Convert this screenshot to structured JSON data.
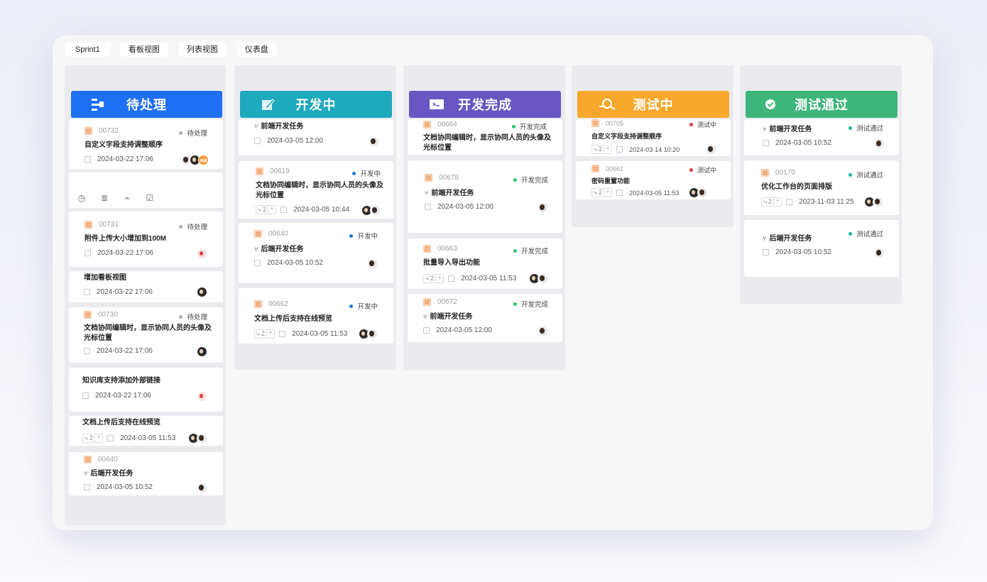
{
  "tabs": [
    "Sprint1",
    "看板视图",
    "列表视图",
    "仪表盘"
  ],
  "colors": {
    "todo": "#1f6ff5",
    "dev": "#1ea9bd",
    "done": "#6a56c2",
    "test": "#f7a82c",
    "pass": "#3db57b"
  },
  "columns": [
    {
      "title": "待处理",
      "cards": [
        {
          "id": "00732",
          "status": "待处理",
          "title": "自定义字段支持调整顺序",
          "date": "2024-03-22 17:06",
          "avatar_badge": "张楠"
        },
        {
          "tools": [
            "clock-icon",
            "list-icon",
            "attach-icon",
            "checkbox-icon"
          ]
        },
        {
          "id": "00731",
          "status": "待处理",
          "title": "附件上传大小增加到100M",
          "date": "2024-03-22 17:06"
        },
        {
          "title": "增加看板视图",
          "date": "2024-03-22 17:06"
        },
        {
          "id": "00730",
          "status": "待处理",
          "title": "文档协同编辑时，显示协同人员的头像及光标位置",
          "date": "2024-03-22 17:06"
        },
        {
          "title": "知识库支持添加外部链接",
          "date": "2024-03-22 17:06"
        },
        {
          "title": "文档上传后支持在线预览",
          "sub": "2",
          "date": "2024-03-05 11:53"
        },
        {
          "id": "00640",
          "title": "后端开发任务",
          "date": "2024-03-05 10:52"
        }
      ]
    },
    {
      "title": "开发中",
      "cards": [
        {
          "title": "前端开发任务",
          "date": "2024-03-05 12:00"
        },
        {
          "id": "00619",
          "status": "开发中",
          "title": "文档协同编辑时，显示协同人员的头像及光标位置",
          "sub": "2",
          "date": "2024-03-05 10:44"
        },
        {
          "id": "00640",
          "status": "开发中",
          "title": "后端开发任务",
          "date": "2024-03-05 10:52"
        },
        {
          "id": "00662",
          "status": "开发中",
          "title": "文档上传后支持在线预览",
          "sub": "2",
          "date": "2024-03-05 11:53"
        }
      ]
    },
    {
      "title": "开发完成",
      "cards": [
        {
          "id": "00664",
          "status": "开发完成",
          "title": "文档协同编辑时，显示协同人员的头像及光标位置"
        },
        {
          "id": "00678",
          "status": "开发完成",
          "title": "前端开发任务",
          "date": "2024-03-05 12:00"
        },
        {
          "id": "00663",
          "status": "开发完成",
          "title": "批量导入导出功能",
          "sub": "2",
          "date": "2024-03-05 11:53"
        },
        {
          "id": "00672",
          "status": "开发完成",
          "title": "前端开发任务",
          "date": "2024-03-05 12:00"
        }
      ]
    },
    {
      "title": "测试中",
      "cards": [
        {
          "id": "00705",
          "status": "测试中",
          "title": "自定义字段支持调整顺序",
          "sub": "2",
          "date": "2024-03-14 10:20"
        },
        {
          "id": "00661",
          "status": "测试中",
          "title": "密码重置功能",
          "sub": "2",
          "date": "2024-03-05 11:53"
        }
      ]
    },
    {
      "title": "测试通过",
      "cards": [
        {
          "status": "测试通过",
          "title": "前端开发任务",
          "date": "2024-03-05 10:52"
        },
        {
          "id": "00170",
          "status": "测试通过",
          "title": "优化工作台的页面排版",
          "sub": "2",
          "date": "2023-11-03 11:25"
        },
        {
          "status": "测试通过",
          "title": "后端开发任务",
          "date": "2024-03-05 10:52"
        }
      ]
    }
  ]
}
